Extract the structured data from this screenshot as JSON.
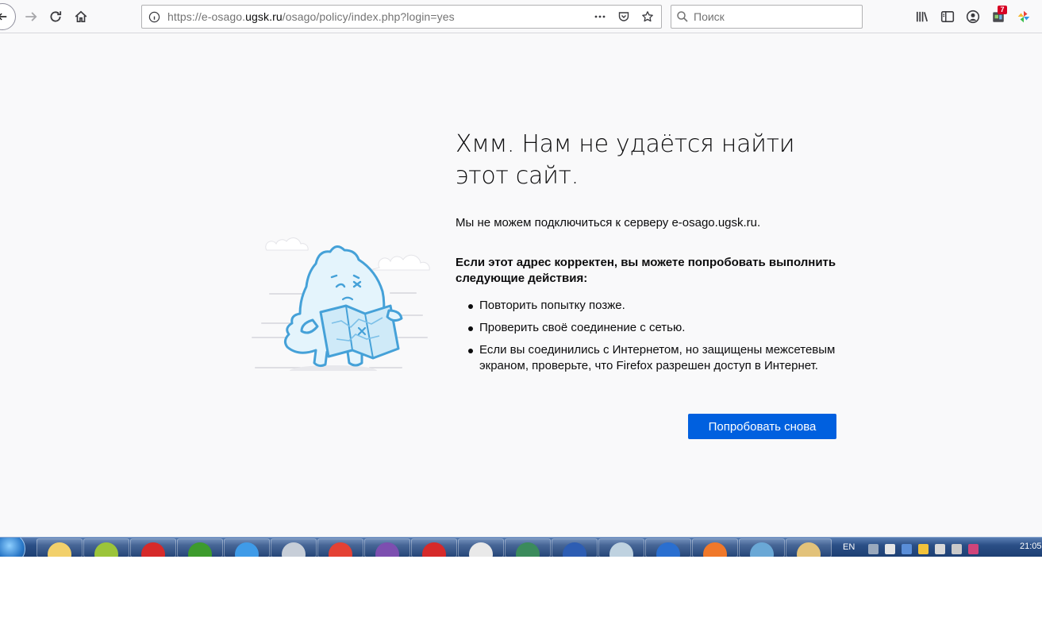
{
  "browser": {
    "url_prefix": "https://e-osago.",
    "url_domain": "ugsk.ru",
    "url_suffix": "/osago/policy/index.php?login=yes",
    "search_placeholder": "Поиск",
    "badge_count": "7"
  },
  "error_page": {
    "title": "Хмм. Нам не удаётся найти этот сайт.",
    "description": "Мы не можем подключиться к серверу e-osago.ugsk.ru.",
    "suggestions_title": "Если этот адрес корректен, вы можете попробовать выполнить следующие действия:",
    "suggestions": [
      "Повторить попытку позже.",
      "Проверить своё соединение с сетью.",
      "Если вы соединились с Интернетом, но защищены межсетевым экраном, проверьте, что Firefox разрешен доступ в Интернет."
    ],
    "try_again_label": "Попробовать снова"
  },
  "taskbar": {
    "items": [
      "folder",
      "7-zip",
      "opera",
      "utorrent",
      "internet-explorer",
      "calculator",
      "chrome",
      "viber",
      "opera",
      "osago",
      "chrome-beta",
      "word",
      "notes",
      "teamviewer",
      "firefox",
      "image-viewer",
      "paint"
    ],
    "language": "EN",
    "clock": "21:05"
  },
  "colors": {
    "accent": "#0060df",
    "page_bg": "#f9f9fa",
    "illustration": "#45a1d8"
  }
}
